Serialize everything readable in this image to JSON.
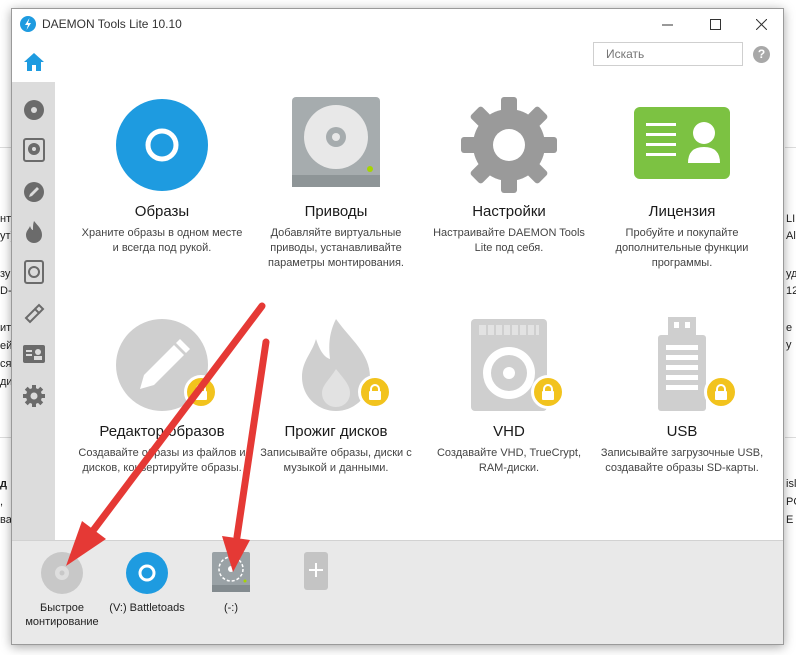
{
  "background": {
    "left_fragments": [
      "нт",
      "ут)",
      "зу",
      "D-",
      "ит",
      "ей",
      "ся",
      "ди"
    ],
    "left_bold": "д",
    "left_lower": [
      ",",
      "ва"
    ],
    "right_fragments": [
      "LI",
      "Al",
      "уд",
      "12",
      "е у"
    ],
    "right_lower": [
      "isl",
      "PO",
      "E"
    ]
  },
  "window": {
    "title": "DAEMON Tools Lite 10.10",
    "search_placeholder": "Искать",
    "help_label": "?"
  },
  "sidebar": {
    "items": [
      {
        "icon": "home-icon"
      },
      {
        "icon": "disc-icon"
      },
      {
        "icon": "drive-icon"
      },
      {
        "icon": "pencil-icon"
      },
      {
        "icon": "flame-icon"
      },
      {
        "icon": "hdd-icon"
      },
      {
        "icon": "usb-icon"
      },
      {
        "icon": "license-icon"
      },
      {
        "icon": "gear-icon"
      }
    ]
  },
  "tiles": [
    {
      "title": "Образы",
      "desc": "Храните образы в одном месте и всегда под рукой.",
      "icon": "images-icon",
      "locked": false
    },
    {
      "title": "Приводы",
      "desc": "Добавляйте виртуальные приводы, устанавливайте параметры монтирования.",
      "icon": "drives-icon",
      "locked": false
    },
    {
      "title": "Настройки",
      "desc": "Настраивайте DAEMON Tools Lite под себя.",
      "icon": "settings-icon",
      "locked": false
    },
    {
      "title": "Лицензия",
      "desc": "Пробуйте и покупайте дополнительные функции программы.",
      "icon": "license-card-icon",
      "locked": false
    },
    {
      "title": "Редактор образов",
      "desc": "Создавайте образы из файлов и дисков, конвертируйте образы.",
      "icon": "image-editor-icon",
      "locked": true
    },
    {
      "title": "Прожиг дисков",
      "desc": "Записывайте образы, диски с музыкой и данными.",
      "icon": "burn-icon",
      "locked": true
    },
    {
      "title": "VHD",
      "desc": "Создавайте VHD, TrueCrypt, RAM-диски.",
      "icon": "vhd-icon",
      "locked": true
    },
    {
      "title": "USB",
      "desc": "Записывайте загрузочные USB, создавайте образы SD-карты.",
      "icon": "usb-drive-icon",
      "locked": true
    }
  ],
  "bottom": {
    "quick_mount": "Быстрое монтирование",
    "drive_v": "(V:) Battletoads",
    "drive_empty": "(-:)",
    "add_icon": "add-drive-icon"
  },
  "colors": {
    "accent_blue": "#1e9be0",
    "license_green": "#7cc242",
    "lock_yellow": "#f2c31d",
    "arrow_red": "#e53935"
  }
}
